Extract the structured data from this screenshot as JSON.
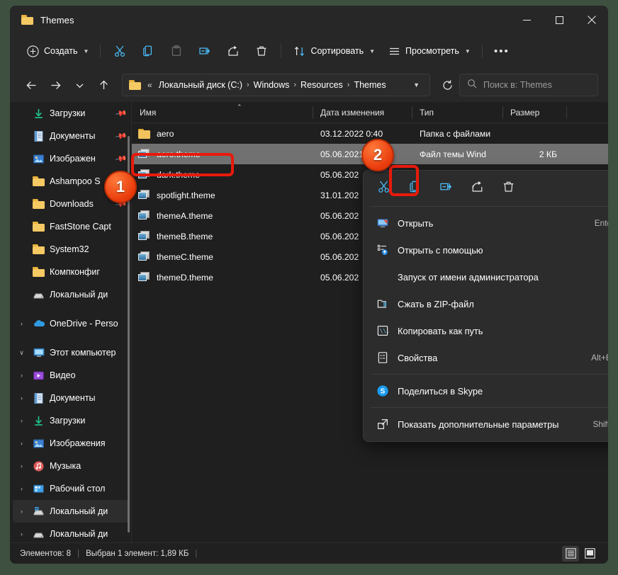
{
  "window": {
    "title": "Themes",
    "controls": {
      "minimize": "—",
      "maximize": "□",
      "close": "✕"
    }
  },
  "toolbar": {
    "new_label": "Создать",
    "cut_name": "cut-icon",
    "copy_name": "copy-icon",
    "paste_name": "paste-icon",
    "rename_name": "rename-icon",
    "share_name": "share-icon",
    "delete_name": "delete-icon",
    "sort_label": "Сортировать",
    "view_label": "Просмотреть",
    "more_label": "•••"
  },
  "address": {
    "breadcrumbs": [
      {
        "label": "Локальный диск (C:)"
      },
      {
        "label": "Windows"
      },
      {
        "label": "Resources"
      },
      {
        "label": "Themes"
      }
    ],
    "ellipsis": "«",
    "separator": "›",
    "refresh_name": "refresh-icon"
  },
  "search": {
    "placeholder": "Поиск в: Themes",
    "value": ""
  },
  "sidebar": {
    "quick_items": [
      {
        "label": "Загрузки",
        "icon": "download-icon",
        "pinned": true,
        "expand": ""
      },
      {
        "label": "Документы",
        "icon": "documents-icon",
        "pinned": true,
        "expand": ""
      },
      {
        "label": "Изображен",
        "icon": "pictures-icon",
        "pinned": true,
        "expand": ""
      },
      {
        "label": "Ashampoo S",
        "icon": "folder-icon",
        "pinned": true,
        "expand": ""
      },
      {
        "label": "Downloads",
        "icon": "folder-icon",
        "pinned": true,
        "expand": ""
      },
      {
        "label": "FastStone Capt",
        "icon": "folder-icon",
        "pinned": false,
        "expand": ""
      },
      {
        "label": "System32",
        "icon": "folder-icon",
        "pinned": false,
        "expand": ""
      },
      {
        "label": "Компконфиг",
        "icon": "folder-icon",
        "pinned": false,
        "expand": ""
      },
      {
        "label": "Локальный ди",
        "icon": "drive-icon",
        "pinned": false,
        "expand": ""
      }
    ],
    "onedrive": {
      "label": "OneDrive - Perso",
      "icon": "onedrive-icon",
      "expand": "›"
    },
    "thispc": {
      "label": "Этот компьютер",
      "icon": "pc-icon",
      "expand": "∨"
    },
    "pc_items": [
      {
        "label": "Видео",
        "icon": "video-icon",
        "expand": "›",
        "selected": false
      },
      {
        "label": "Документы",
        "icon": "documents-icon",
        "expand": "›",
        "selected": false
      },
      {
        "label": "Загрузки",
        "icon": "download-icon",
        "expand": "›",
        "selected": false
      },
      {
        "label": "Изображения",
        "icon": "pictures-icon",
        "expand": "›",
        "selected": false
      },
      {
        "label": "Музыка",
        "icon": "music-icon",
        "expand": "›",
        "selected": false
      },
      {
        "label": "Рабочий стол",
        "icon": "desktop-icon",
        "expand": "›",
        "selected": false
      },
      {
        "label": "Локальный ди",
        "icon": "windrive-icon",
        "expand": "›",
        "selected": true
      },
      {
        "label": "Локальный ди",
        "icon": "drive-icon",
        "expand": "›",
        "selected": false
      }
    ]
  },
  "filelist": {
    "columns": [
      {
        "label": "Имя",
        "sorted": true,
        "caret": "⌃"
      },
      {
        "label": "Дата изменения"
      },
      {
        "label": "Тип"
      },
      {
        "label": "Размер"
      }
    ],
    "rows": [
      {
        "name": "aero",
        "date": "03.12.2022 0:40",
        "type": "Папка с файлами",
        "size": "",
        "icon": "folder-icon",
        "selected": false
      },
      {
        "name": "aero.theme",
        "date": "05.06.2021 1",
        "type": "Файл темы Wind",
        "size": "2 КБ",
        "icon": "theme-file-icon",
        "selected": true
      },
      {
        "name": "dark.theme",
        "date": "05.06.202",
        "type": "",
        "size": "",
        "icon": "theme-file-icon",
        "selected": false
      },
      {
        "name": "spotlight.theme",
        "date": "31.01.202",
        "type": "",
        "size": "",
        "icon": "theme-file-icon",
        "selected": false
      },
      {
        "name": "themeA.theme",
        "date": "05.06.202",
        "type": "",
        "size": "",
        "icon": "theme-file-icon",
        "selected": false
      },
      {
        "name": "themeB.theme",
        "date": "05.06.202",
        "type": "",
        "size": "",
        "icon": "theme-file-icon",
        "selected": false
      },
      {
        "name": "themeC.theme",
        "date": "05.06.202",
        "type": "",
        "size": "",
        "icon": "theme-file-icon",
        "selected": false
      },
      {
        "name": "themeD.theme",
        "date": "05.06.202",
        "type": "",
        "size": "",
        "icon": "theme-file-icon",
        "selected": false
      }
    ]
  },
  "context_menu": {
    "toolbar": [
      {
        "name": "cut-icon"
      },
      {
        "name": "copy-icon"
      },
      {
        "name": "rename-icon"
      },
      {
        "name": "share-icon"
      },
      {
        "name": "delete-icon"
      }
    ],
    "items": [
      {
        "label": "Открыть",
        "accel": "Enter",
        "icon": "open-icon"
      },
      {
        "label": "Открыть с помощью",
        "accel": "",
        "icon": "open-with-icon"
      },
      {
        "label": "Запуск от имени администратора",
        "accel": "",
        "icon": ""
      },
      {
        "label": "Сжать в ZIP-файл",
        "accel": "",
        "icon": "zip-icon"
      },
      {
        "label": "Копировать как путь",
        "accel": "",
        "icon": "copy-path-icon"
      },
      {
        "label": "Свойства",
        "accel": "Alt+Eг",
        "icon": "properties-icon"
      }
    ],
    "skype": {
      "label": "Поделиться в Skype",
      "icon": "skype-icon"
    },
    "more": {
      "label": "Показать дополнительные параметры",
      "accel": "Shift+",
      "icon": "more-options-icon"
    }
  },
  "statusbar": {
    "count": "Элементов: 8",
    "selection": "Выбран 1 элемент: 1,89 КБ",
    "divider": "|",
    "details_view": "details-view-icon",
    "large_view": "large-icons-view-icon"
  },
  "annotations": [
    {
      "number": "1"
    },
    {
      "number": "2"
    }
  ],
  "colors": {
    "accent_red": "#e81a0c",
    "badge_orange": "#e8390a",
    "window_bg": "#1f1f1f",
    "chrome_bg": "#272727",
    "selection": "#717171",
    "icon_blue": "#4cc2ff"
  }
}
